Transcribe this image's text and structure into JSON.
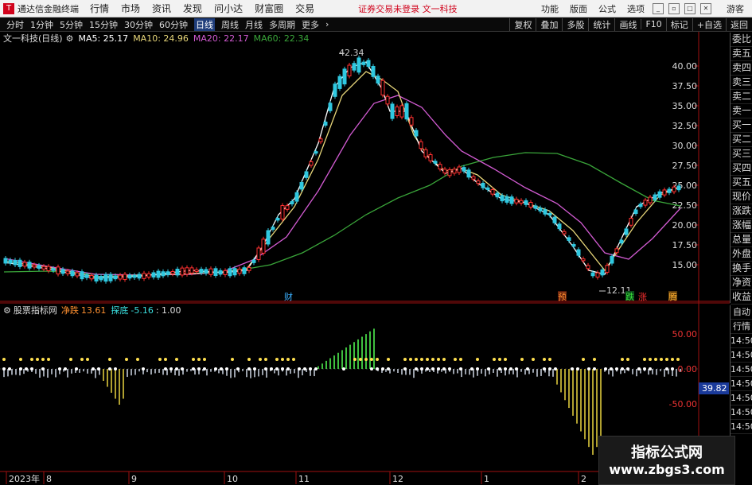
{
  "menubar": {
    "app_title": "通达信金融终端",
    "items": [
      "行情",
      "市场",
      "资讯",
      "发现",
      "问小达",
      "财富圈",
      "交易"
    ],
    "login_warning": "证券交易未登录  文一科技",
    "right_items": [
      "功能",
      "版面",
      "公式",
      "选项"
    ],
    "guest": "游客"
  },
  "periodbar": {
    "items": [
      "分时",
      "1分钟",
      "5分钟",
      "15分钟",
      "30分钟",
      "60分钟",
      "日线",
      "周线",
      "月线",
      "多周期",
      "更多"
    ],
    "active": "日线",
    "right_items": [
      "复权",
      "叠加",
      "多股",
      "统计",
      "画线",
      "F10",
      "标记",
      "+自选",
      "返回"
    ]
  },
  "chart": {
    "stock": "文一科技(日线)",
    "ma5": "MA5: 25.17",
    "ma10": "MA10: 24.96",
    "ma20": "MA20: 22.17",
    "ma60": "MA60: 22.34",
    "high_label": "42.34",
    "low_label": "12.11",
    "y_ticks": [
      "40.00",
      "37.50",
      "35.00",
      "32.50",
      "30.00",
      "27.50",
      "25.00",
      "22.50",
      "20.00",
      "17.50",
      "15.00"
    ],
    "markers": [
      "财",
      "预",
      "跌",
      "涨",
      "腾"
    ],
    "colors": {
      "ma5": "#ffffff",
      "ma10": "#e8d77a",
      "ma20": "#d25bd2",
      "ma60": "#3aa63a",
      "up": "#ff3030",
      "down": "#2fc8e0"
    }
  },
  "side_panel": [
    "委比",
    "卖五",
    "卖四",
    "卖三",
    "卖二",
    "卖一",
    "买一",
    "买二",
    "买三",
    "买四",
    "买五",
    "现价",
    "涨跌",
    "涨幅",
    "总量",
    "外盘",
    "换手",
    "净资",
    "收益"
  ],
  "side_panel2": [
    "自动",
    "行情",
    "14:50",
    "14:50",
    "14:50",
    "14:50",
    "14:50",
    "14:50",
    "14:50"
  ],
  "indicator": {
    "name": "股票指标网",
    "label1": "净跌",
    "value1": "13.61",
    "label2": "探底",
    "value2": "-5.16",
    "value3": ": 1.00",
    "y_ticks": [
      "50.00",
      "0.00",
      "-50.00"
    ],
    "current": "39.82"
  },
  "x_axis": [
    "2023年",
    "8",
    "9",
    "10",
    "11",
    "12",
    "1",
    "2"
  ],
  "watermark": {
    "title": "指标公式网",
    "url": "www.zbgs3.com"
  }
}
